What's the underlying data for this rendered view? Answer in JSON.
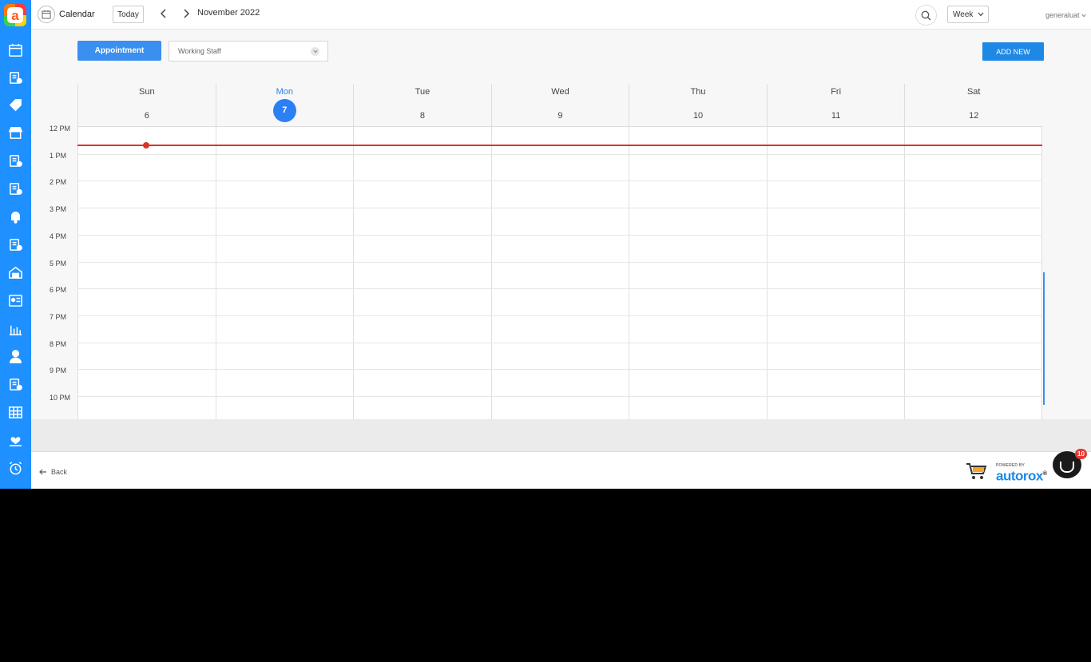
{
  "topbar": {
    "title": "Calendar",
    "today_label": "Today",
    "month_label": "November 2022",
    "view_selected": "Week",
    "user_name": "generaluat"
  },
  "toolbar": {
    "appointment_label": "Appointment",
    "staff_select_value": "Working Staff",
    "add_new_label": "ADD NEW"
  },
  "calendar": {
    "days": [
      {
        "name": "Sun",
        "date": "6"
      },
      {
        "name": "Mon",
        "date": "7"
      },
      {
        "name": "Tue",
        "date": "8"
      },
      {
        "name": "Wed",
        "date": "9"
      },
      {
        "name": "Thu",
        "date": "10"
      },
      {
        "name": "Fri",
        "date": "11"
      },
      {
        "name": "Sat",
        "date": "12"
      }
    ],
    "active_day_index": 1,
    "time_slots": [
      "12 PM",
      "1 PM",
      "2 PM",
      "3 PM",
      "4 PM",
      "5 PM",
      "6 PM",
      "7 PM",
      "8 PM",
      "9 PM",
      "10 PM"
    ]
  },
  "footer": {
    "back_label": "Back",
    "powered_by": "POWERED BY",
    "brand_name": "autorox",
    "registered": "®",
    "chat_badge_count": "10"
  },
  "sidebar": {
    "icons": [
      "calendar-icon",
      "jobcard-icon",
      "tag-icon",
      "store-icon",
      "parts-icon",
      "staff-icon",
      "bell-icon",
      "invoice-icon",
      "garage-icon",
      "id-card-icon",
      "report-icon",
      "user-icon",
      "inventory-icon",
      "table-icon",
      "care-icon",
      "alarm-icon"
    ]
  },
  "colors": {
    "sidebar": "#1e90ff",
    "accent": "#2d7ff5",
    "now_line": "#d9342b",
    "badge": "#e53935"
  }
}
